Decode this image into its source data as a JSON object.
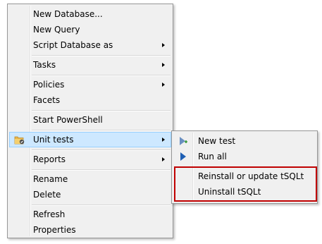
{
  "context_menu": {
    "items": [
      {
        "label": "New Database...",
        "has_submenu": false
      },
      {
        "label": "New Query",
        "has_submenu": false
      },
      {
        "label": "Script Database as",
        "has_submenu": true
      },
      {
        "label": "Tasks",
        "has_submenu": true
      },
      {
        "label": "Policies",
        "has_submenu": true
      },
      {
        "label": "Facets",
        "has_submenu": false
      },
      {
        "label": "Start PowerShell",
        "has_submenu": false
      },
      {
        "label": "Unit tests",
        "has_submenu": true,
        "selected": true,
        "icon": "unit-tests-icon"
      },
      {
        "label": "Reports",
        "has_submenu": true
      },
      {
        "label": "Rename",
        "has_submenu": false
      },
      {
        "label": "Delete",
        "has_submenu": false
      },
      {
        "label": "Refresh",
        "has_submenu": false
      },
      {
        "label": "Properties",
        "has_submenu": false
      }
    ]
  },
  "unit_tests_submenu": {
    "items": [
      {
        "label": "New test",
        "icon": "new-test-icon"
      },
      {
        "label": "Run all",
        "icon": "run-all-icon"
      },
      {
        "label": "Reinstall or update tSQLt",
        "highlighted": true
      },
      {
        "label": "Uninstall tSQLt",
        "highlighted": true
      }
    ]
  },
  "colors": {
    "menu_background": "#f0f0f0",
    "selected_background": "#cde8ff",
    "selected_border": "#99d1ff",
    "highlight_box": "#c00000",
    "run_icon": "#1e5fb4"
  }
}
